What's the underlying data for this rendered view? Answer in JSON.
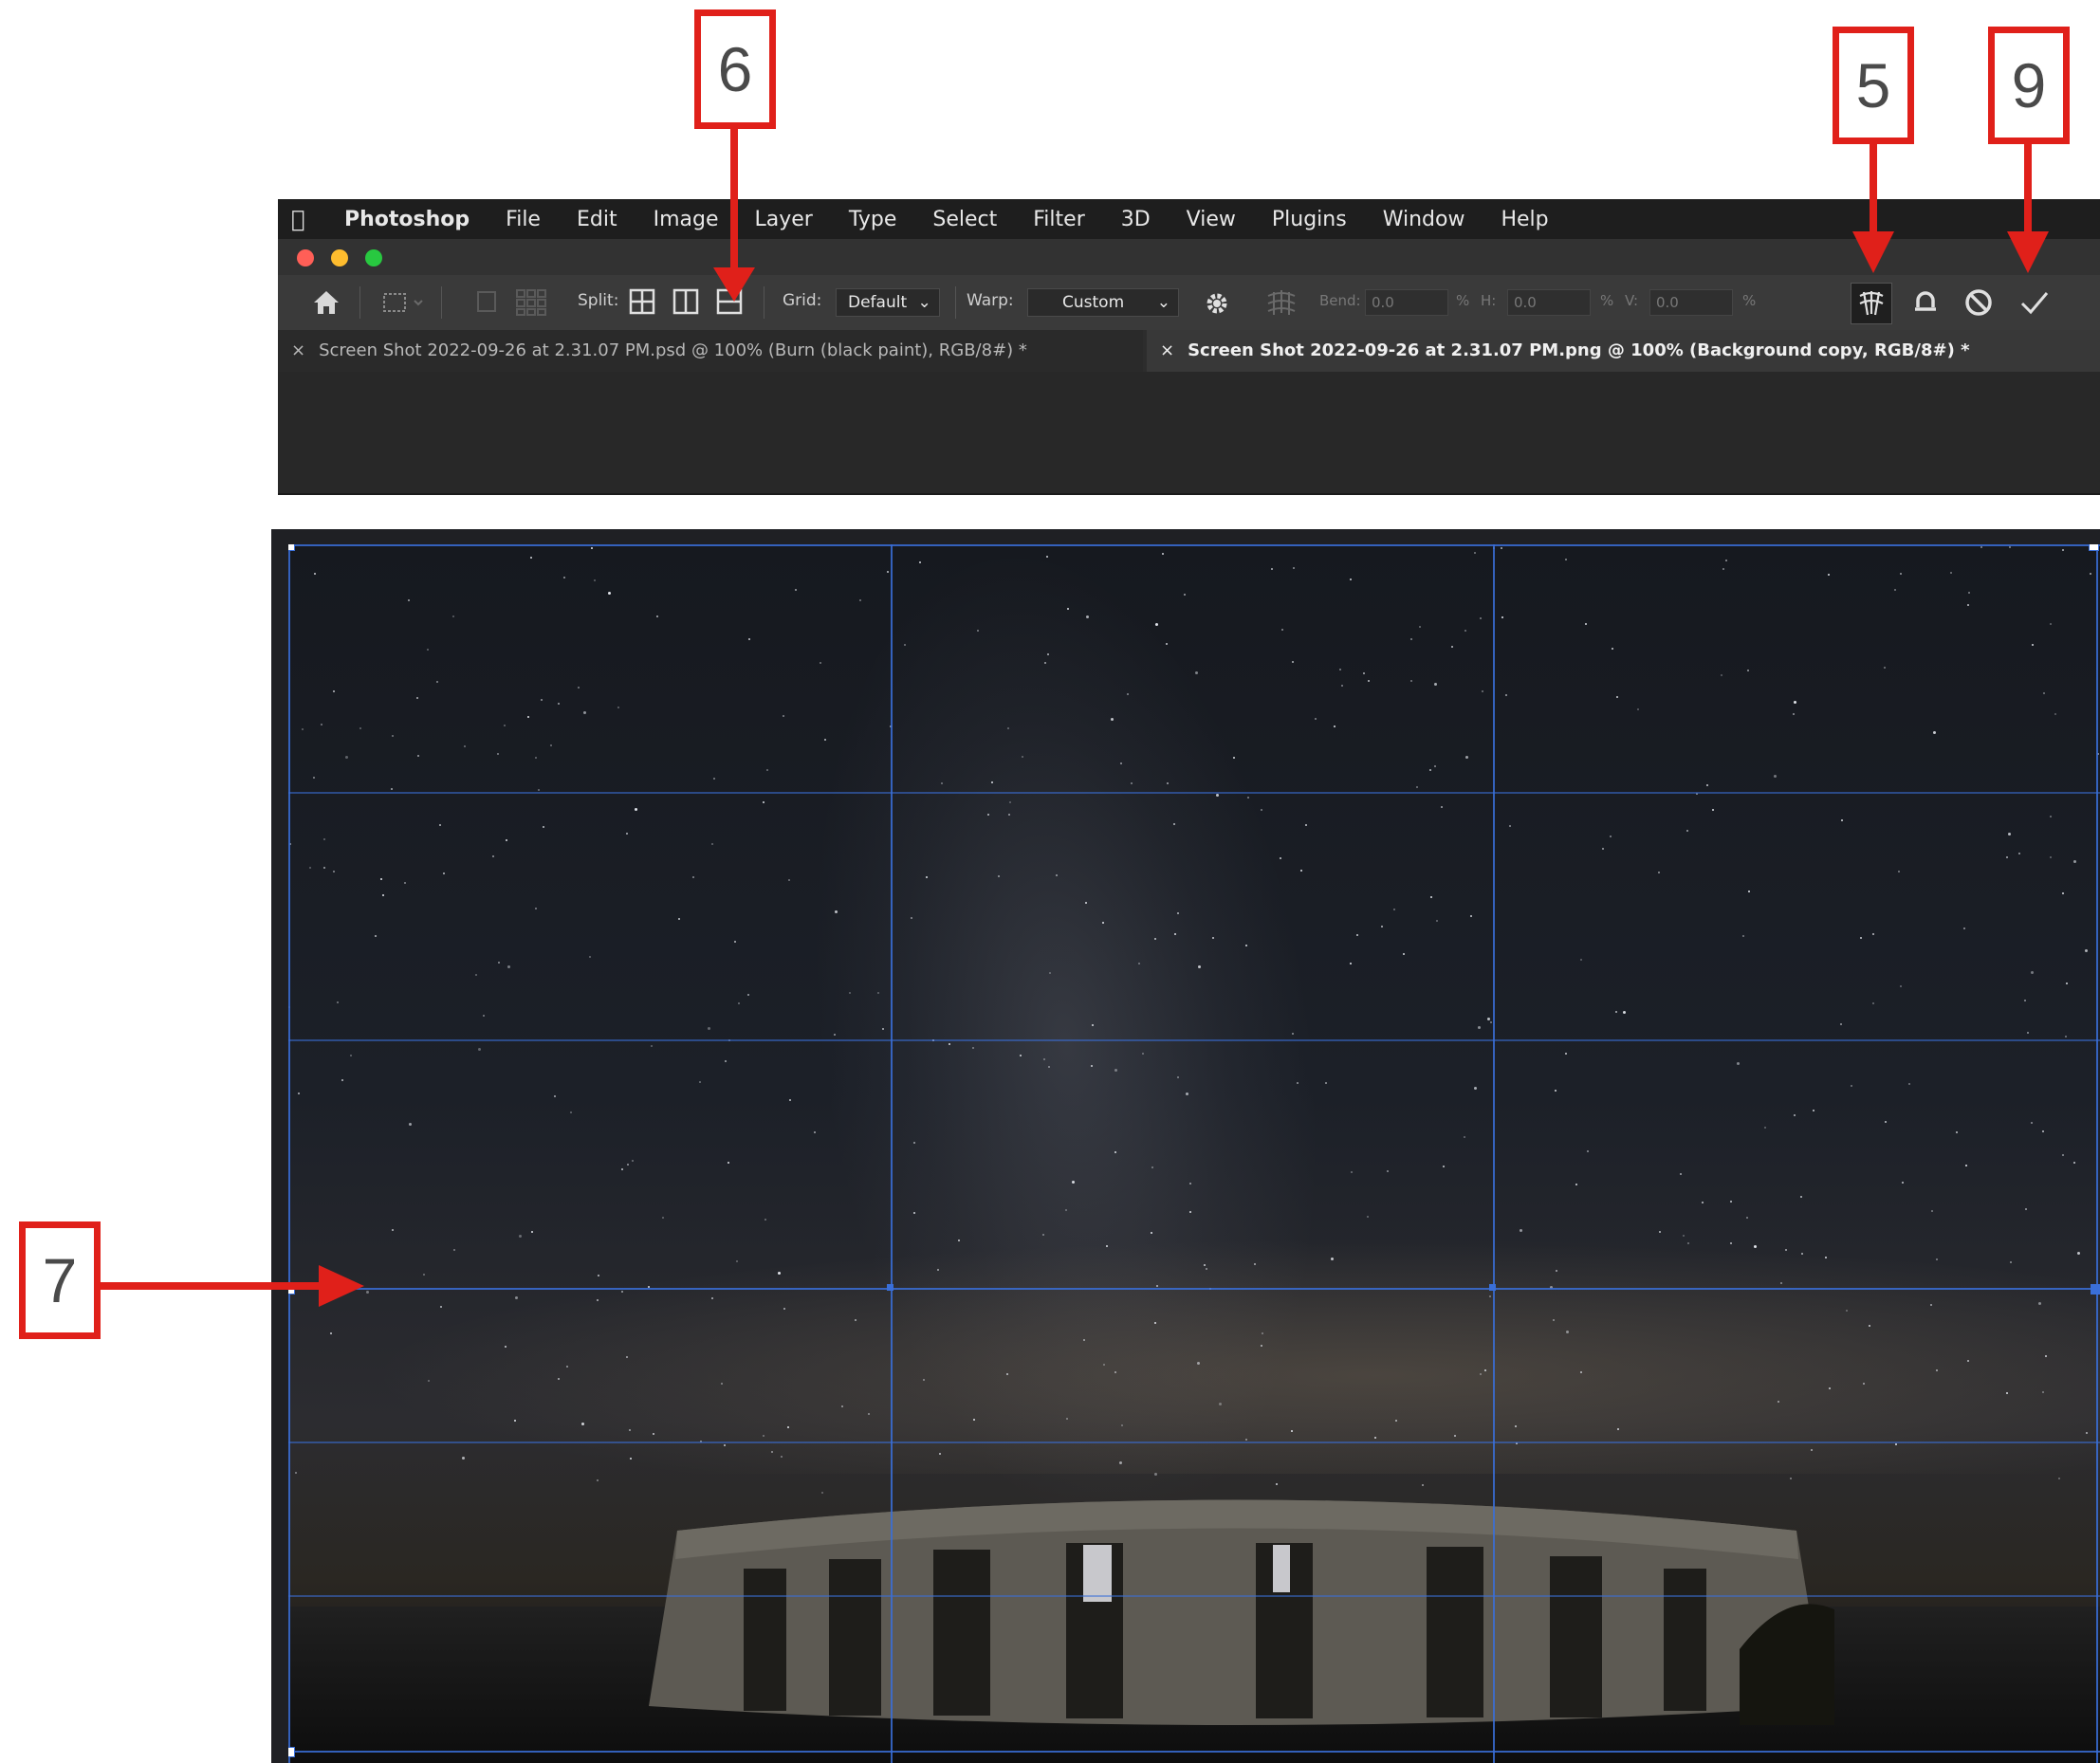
{
  "menubar": {
    "items": [
      "Photoshop",
      "File",
      "Edit",
      "Image",
      "Layer",
      "Type",
      "Select",
      "Filter",
      "3D",
      "View",
      "Plugins",
      "Window",
      "Help"
    ]
  },
  "options_bar": {
    "split_label": "Split:",
    "grid_label": "Grid:",
    "grid_value": "Default",
    "warp_label": "Warp:",
    "warp_value": "Custom",
    "bend_label": "Bend:",
    "bend_value": "0.0",
    "h_label": "H:",
    "h_value": "0.0",
    "v_label": "V:",
    "v_value": "0.0",
    "percent": "%"
  },
  "tabs": [
    {
      "label": "Screen Shot 2022-09-26 at 2.31.07 PM.psd @ 100% (Burn (black paint), RGB/8#) *",
      "active": false
    },
    {
      "label": "Screen Shot 2022-09-26 at 2.31.07 PM.png @ 100% (Background copy, RGB/8#) *",
      "active": true
    }
  ],
  "annotations": {
    "five": "5",
    "six": "6",
    "seven": "7",
    "nine": "9"
  },
  "colors": {
    "annotation_red": "#e0201a",
    "grid_blue": "#3a6fd8",
    "chrome_dark": "#1e1e1e"
  },
  "icons": {
    "apple": "apple-icon",
    "home": "home-icon",
    "gear": "gear-icon",
    "warp_toggle": "warp-mesh-icon",
    "reset": "undo-icon",
    "cancel": "cancel-icon",
    "commit": "checkmark-icon"
  }
}
